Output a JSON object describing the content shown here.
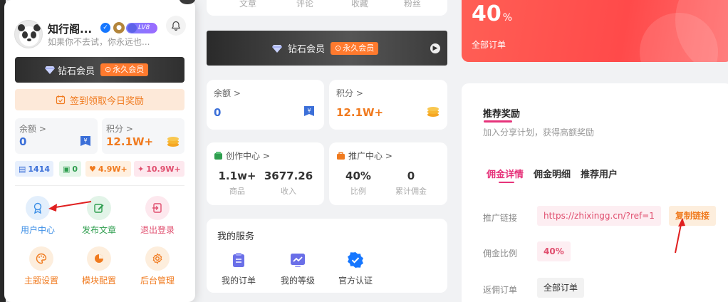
{
  "user": {
    "name": "知行阁...",
    "motto": "如果你不去试，你永远也...",
    "level_badge": "LV8"
  },
  "vip": {
    "label": "钻石会员",
    "tag": "永久会员"
  },
  "checkin": {
    "label": "签到领取今日奖励"
  },
  "wallet": {
    "balance_label": "余额 >",
    "balance_value": "0",
    "points_label": "积分 >",
    "points_value": "12.1W+"
  },
  "stats": {
    "posts": "1414",
    "comments": "0",
    "likes": "4.9W+",
    "hot": "10.9W+"
  },
  "menu": {
    "items": [
      {
        "label": "用户中心",
        "icon": "medal-icon",
        "color": "#3b8ee6"
      },
      {
        "label": "发布文章",
        "icon": "edit-icon",
        "color": "#2f9e4f"
      },
      {
        "label": "退出登录",
        "icon": "logout-icon",
        "color": "#e04e6e"
      },
      {
        "label": "主题设置",
        "icon": "palette-icon",
        "color": "#f07a1e"
      },
      {
        "label": "模块配置",
        "icon": "pie-chart-icon",
        "color": "#f07a1e"
      },
      {
        "label": "后台管理",
        "icon": "gear-icon",
        "color": "#f07a1e"
      }
    ]
  },
  "profile_stats": {
    "labels": [
      "文章",
      "评论",
      "收藏",
      "粉丝"
    ]
  },
  "creator": {
    "title": "创作中心 >",
    "goods_value": "1.1w+",
    "goods_label": "商品",
    "income_value": "3677.26",
    "income_label": "收入"
  },
  "promotion": {
    "title": "推广中心 >",
    "ratio_value": "40%",
    "ratio_label": "比例",
    "commission_value": "0",
    "commission_label": "累计佣金"
  },
  "services": {
    "title": "我的服务",
    "items": [
      {
        "label": "我的订单",
        "icon": "clipboard-icon"
      },
      {
        "label": "我的等级",
        "icon": "chart-icon"
      },
      {
        "label": "官方认证",
        "icon": "verified-icon"
      }
    ]
  },
  "orders": {
    "percent": "40",
    "percent_unit": "%",
    "label": "全部订单"
  },
  "referral": {
    "title": "推荐奖励",
    "subtitle": "加入分享计划，获得高额奖励",
    "tabs": [
      "佣金详情",
      "佣金明细",
      "推荐用户"
    ],
    "link_label": "推广链接",
    "link_value": "https://zhixingg.cn/?ref=1",
    "copy_label": "复制链接",
    "ratio_label": "佣金比例",
    "ratio_value": "40%",
    "orders_label": "返佣订单",
    "orders_value": "全部订单"
  },
  "colors": {
    "accent_pink": "#e6337a",
    "accent_orange": "#f07a1e",
    "blue": "#3b6fd8",
    "red": "#ff4a4a"
  }
}
